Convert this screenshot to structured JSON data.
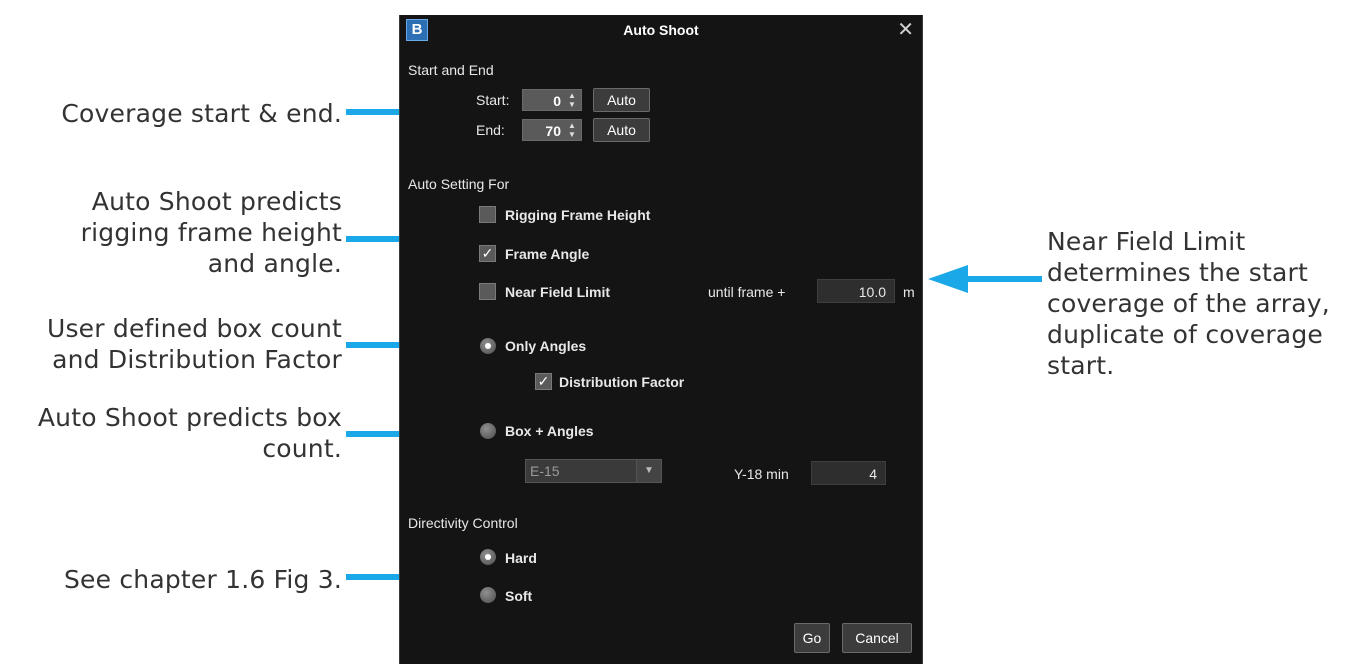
{
  "annotations": {
    "coverage": "Coverage start & end.",
    "rigging_1": "Auto Shoot predicts",
    "rigging_2": "rigging frame height",
    "rigging_3": "and angle.",
    "user_1": "User defined box count",
    "user_2": "and Distribution  Factor",
    "box_1": "Auto Shoot predicts box",
    "box_2": "count.",
    "chapter": "See  chapter 1.6  Fig 3.",
    "near_1": "Near Field Limit",
    "near_2": "determines the start",
    "near_3": "coverage of the array,",
    "near_4": "duplicate of coverage",
    "near_5": "start.",
    "arrow_color": "#1aa8e8"
  },
  "dialog": {
    "logo": "B",
    "title": "Auto Shoot",
    "close": "✕",
    "start_end": {
      "heading": "Start and End",
      "start_label": "Start:",
      "start_value": "0",
      "end_label": "End:",
      "end_value": "70",
      "auto_label": "Auto"
    },
    "auto_setting": {
      "heading": "Auto Setting For",
      "rigging_frame_height": "Rigging Frame Height",
      "frame_angle": "Frame Angle",
      "near_field_limit": "Near Field Limit",
      "until_frame_label": "until frame +",
      "until_frame_value": "10.0",
      "unit": "m"
    },
    "mode": {
      "only_angles": "Only Angles",
      "distribution_factor": "Distribution Factor",
      "box_angles": "Box + Angles",
      "box_type": "E-15",
      "y18_label": "Y-18 min",
      "y18_value": "4"
    },
    "directivity": {
      "heading": "Directivity Control",
      "hard": "Hard",
      "soft": "Soft"
    },
    "buttons": {
      "go": "Go",
      "cancel": "Cancel"
    }
  }
}
